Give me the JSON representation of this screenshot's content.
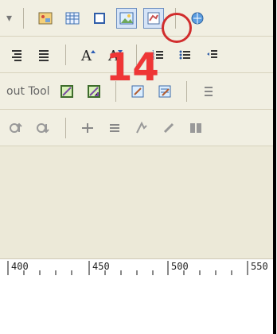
{
  "toolbar": {
    "row2_label": "out Tool"
  },
  "ruler": {
    "ticks": [
      "400",
      "450",
      "500",
      "550"
    ]
  },
  "callout": {
    "number": "14"
  },
  "colors": {
    "callout": "#ef3636",
    "ring": "#d12d2d"
  }
}
